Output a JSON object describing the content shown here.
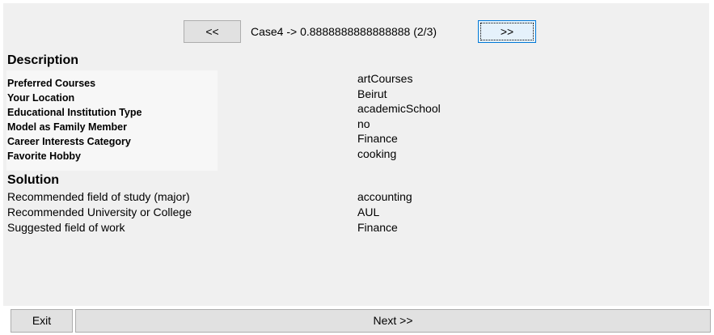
{
  "nav": {
    "prev_label": "<<",
    "case_text": "Case4 -> 0.8888888888888888 (2/3)",
    "next_label": ">>"
  },
  "description": {
    "title": "Description",
    "rows": [
      {
        "label": "Preferred Courses",
        "value": "artCourses"
      },
      {
        "label": "Your Location",
        "value": "Beirut"
      },
      {
        "label": "Educational Institution Type",
        "value": "academicSchool"
      },
      {
        "label": "Model as Family Member",
        "value": "no"
      },
      {
        "label": "Career Interests Category",
        "value": "Finance"
      },
      {
        "label": "Favorite Hobby",
        "value": "cooking"
      }
    ]
  },
  "solution": {
    "title": "Solution",
    "rows": [
      {
        "label": "Recommended field of study (major)",
        "value": "accounting"
      },
      {
        "label": "Recommended University or College",
        "value": "AUL"
      },
      {
        "label": "Suggested field of work",
        "value": "Finance"
      }
    ]
  },
  "bottom": {
    "exit_label": "Exit",
    "next_label": "Next >>"
  },
  "colors": {
    "panel": "#f0f0f0",
    "button": "#e1e1e1",
    "focus_border": "#0078d7"
  }
}
